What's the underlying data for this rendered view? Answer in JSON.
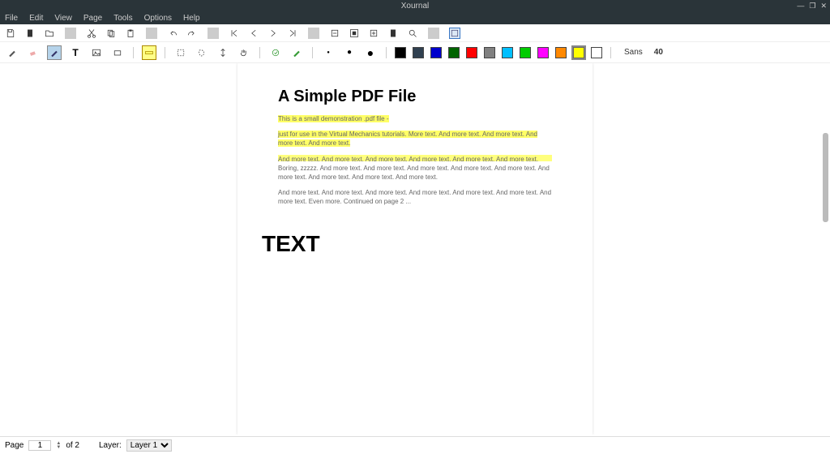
{
  "app": {
    "title": "Xournal"
  },
  "menu": {
    "items": [
      "File",
      "Edit",
      "View",
      "Page",
      "Tools",
      "Options",
      "Help"
    ]
  },
  "toolbar1_icons": [
    "save",
    "new",
    "open",
    "cut",
    "copy",
    "paste",
    "undo",
    "redo",
    "first",
    "prev",
    "next",
    "last",
    "zoom-out",
    "page-fit",
    "zoom-in",
    "fullscreen",
    "zoom",
    "toggle"
  ],
  "tools": {
    "pen": "✎",
    "eraser": "erase",
    "highlighter": "▰",
    "text": "T",
    "image": "img",
    "shapes": "▢",
    "ruler": "ruler",
    "select_rect": "▭",
    "select_region": "⬚",
    "vspace": "↕",
    "hand": "✋",
    "default": "↖",
    "fine": "·",
    "medium": "•"
  },
  "colors": {
    "palette": [
      "#000000",
      "#4a4a4a",
      "#0000ff",
      "#006400",
      "#ff0000",
      "#808080",
      "#00bfff",
      "#00ff00",
      "#ff00ff",
      "#ff8800",
      "#ffff00",
      "#ffffff"
    ],
    "selected": "#ffff00"
  },
  "font": {
    "family": "Sans",
    "size": "40"
  },
  "document": {
    "title": "A Simple PDF File",
    "p1": "This is a small demonstration .pdf file -",
    "p2": "just for use in the Virtual Mechanics tutorials. More text. And more text. And more text. And more text. And more text.",
    "p3": "And more text. And more text. And more text. And more text. And more text. And more text. Boring, zzzzz. And more text. And more text. And more text. And more text. And more text. And more text. And more text. And more text. And more text.",
    "p4": "And more text. And more text. And more text. And more text. And more text. And more text. And more text. Even more. Continued on page 2 ...",
    "annotation": "TEXT"
  },
  "status": {
    "page_label": "Page",
    "page_current": "1",
    "page_of": "of 2",
    "layer_label": "Layer:",
    "layer_value": "Layer 1"
  }
}
